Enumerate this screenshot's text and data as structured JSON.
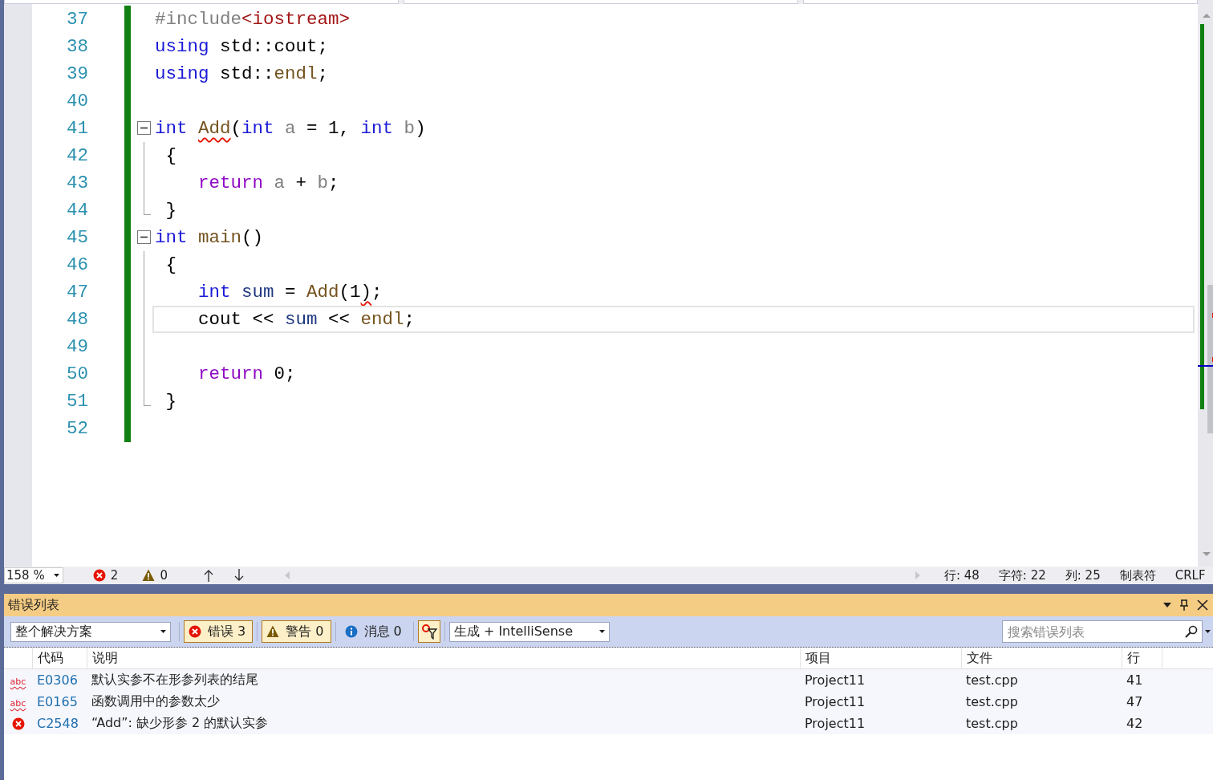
{
  "editor": {
    "lines": [
      {
        "number": "37",
        "changed": true,
        "tokens": [
          {
            "text": "#include",
            "kind": "preprocessor"
          },
          {
            "text": "<iostream>",
            "kind": "string"
          }
        ]
      },
      {
        "number": "38",
        "changed": true,
        "tokens": [
          {
            "text": "using",
            "kind": "keyword"
          },
          {
            "text": " std::cout;",
            "kind": "plain"
          }
        ]
      },
      {
        "number": "39",
        "changed": true,
        "tokens": [
          {
            "text": "using",
            "kind": "keyword"
          },
          {
            "text": " std::",
            "kind": "plain"
          },
          {
            "text": "endl",
            "kind": "function"
          },
          {
            "text": ";",
            "kind": "plain"
          }
        ]
      },
      {
        "number": "40",
        "changed": true
      },
      {
        "number": "41",
        "changed": true,
        "expanded": true,
        "tokens": [
          {
            "text": "int ",
            "kind": "keyword"
          },
          {
            "text": "Add",
            "kind": "function",
            "error": true
          },
          {
            "text": "(",
            "kind": "plain"
          },
          {
            "text": "int",
            "kind": "keyword"
          },
          {
            "text": " a",
            "kind": "parameter"
          },
          {
            "text": " = 1, ",
            "kind": "plain"
          },
          {
            "text": "int",
            "kind": "keyword"
          },
          {
            "text": " b",
            "kind": "parameter"
          },
          {
            "text": ")",
            "kind": "plain"
          }
        ],
        "children": [
          {
            "number": "42",
            "changed": true,
            "tokens": [
              {
                "text": "{",
                "kind": "plain"
              }
            ]
          },
          {
            "number": "43",
            "changed": true,
            "tokens": [
              {
                "text": "   return",
                "kind": "control"
              },
              {
                "text": " a",
                "kind": "parameter"
              },
              {
                "text": " + ",
                "kind": "plain"
              },
              {
                "text": "b",
                "kind": "parameter"
              },
              {
                "text": ";",
                "kind": "plain"
              }
            ]
          },
          {
            "number": "44",
            "changed": true,
            "tokens": [
              {
                "text": "}",
                "kind": "plain"
              }
            ]
          }
        ]
      },
      {
        "number": "45",
        "changed": true,
        "expanded": true,
        "tokens": [
          {
            "text": "int ",
            "kind": "keyword"
          },
          {
            "text": "main",
            "kind": "function"
          },
          {
            "text": "()",
            "kind": "plain"
          }
        ],
        "children": [
          {
            "number": "46",
            "changed": true,
            "tokens": [
              {
                "text": "{",
                "kind": "plain"
              }
            ]
          },
          {
            "number": "47",
            "changed": true,
            "tokens": [
              {
                "text": "   int",
                "kind": "keyword"
              },
              {
                "text": " sum",
                "kind": "variable"
              },
              {
                "text": " = ",
                "kind": "plain"
              },
              {
                "text": "Add",
                "kind": "function"
              },
              {
                "text": "(1",
                "kind": "plain"
              },
              {
                "text": ")",
                "kind": "plain",
                "error": true
              },
              {
                "text": ";",
                "kind": "plain"
              }
            ]
          },
          {
            "number": "48",
            "changed": true,
            "current": true,
            "tokens": [
              {
                "text": "   cout << ",
                "kind": "plain"
              },
              {
                "text": "sum",
                "kind": "variable"
              },
              {
                "text": " << ",
                "kind": "plain"
              },
              {
                "text": "endl",
                "kind": "function"
              },
              {
                "text": ";",
                "kind": "plain"
              }
            ]
          },
          {
            "number": "49",
            "changed": true
          },
          {
            "number": "50",
            "changed": true,
            "tokens": [
              {
                "text": "   return",
                "kind": "control"
              },
              {
                "text": " 0;",
                "kind": "plain"
              }
            ]
          },
          {
            "number": "51",
            "changed": true,
            "tokens": [
              {
                "text": "}",
                "kind": "plain"
              }
            ]
          }
        ]
      },
      {
        "number": "52",
        "changed": true
      }
    ]
  },
  "status_bar": {
    "zoom": "158 %",
    "errors": "2",
    "warnings": "0",
    "position": [
      "行: 48",
      "字符: 22",
      "列: 25",
      "制表符",
      "CRLF"
    ]
  },
  "error_list": {
    "title": "错误列表",
    "scope": "整个解决方案",
    "filters": [
      {
        "kind": "error",
        "label": "错误 3",
        "selected": true
      },
      {
        "kind": "warning",
        "label": "警告 0",
        "selected": true
      },
      {
        "kind": "message",
        "label": "消息 0",
        "selected": false
      }
    ],
    "source": "生成 + IntelliSense",
    "search": {
      "placeholder": "搜索错误列表"
    },
    "columns": [
      "代码",
      "说明",
      "项目",
      "文件",
      "行"
    ],
    "rows": [
      {
        "kind": "intellisense",
        "badge": "abc",
        "code": "E0306",
        "description": "默认实参不在形参列表的结尾",
        "project": "Project11",
        "file": "test.cpp",
        "line": "41"
      },
      {
        "kind": "intellisense",
        "badge": "abc",
        "code": "E0165",
        "description": "函数调用中的参数太少",
        "project": "Project11",
        "file": "test.cpp",
        "line": "47"
      },
      {
        "kind": "error",
        "code": "C2548",
        "description": "“Add”: 缺少形参 2 的默认实参",
        "project": "Project11",
        "file": "test.cpp",
        "line": "42"
      }
    ]
  }
}
